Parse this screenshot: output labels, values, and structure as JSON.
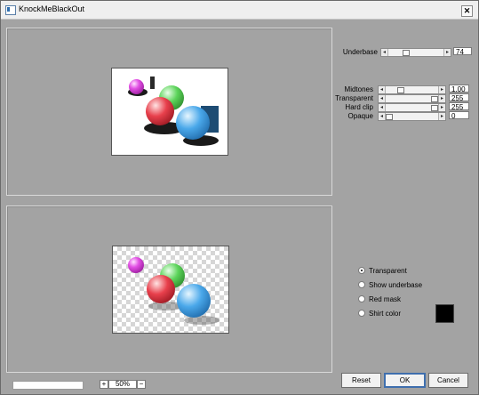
{
  "window": {
    "title": "KnockMeBlackOut",
    "close_glyph": "✕",
    "icon": "window-app-icon"
  },
  "sliders": {
    "underbase": {
      "label": "Underbase",
      "value": "74",
      "level": 0.29
    },
    "midtones": {
      "label": "Midtones",
      "value": "1.00",
      "level": 0.25
    },
    "transparent": {
      "label": "Transparent",
      "value": "255",
      "level": 1.0
    },
    "hard_clip": {
      "label": "Hard clip",
      "value": "255",
      "level": 1.0
    },
    "opaque": {
      "label": "Opaque",
      "value": "0",
      "level": 0.0
    }
  },
  "arrows": {
    "left": "◂",
    "right": "▸"
  },
  "view_options": {
    "transparent": "Transparent",
    "show_underbase": "Show underbase",
    "red_mask": "Red mask",
    "shirt_color": "Shirt color",
    "selected": "transparent",
    "shirt_color_value": "#000000"
  },
  "buttons": {
    "reset": "Reset",
    "ok": "OK",
    "cancel": "Cancel"
  },
  "zoom": {
    "plus": "+",
    "value": "50%",
    "minus": "−"
  },
  "colors": {
    "window_bg": "#a3a3a3",
    "ok_border": "#3f6fae"
  }
}
